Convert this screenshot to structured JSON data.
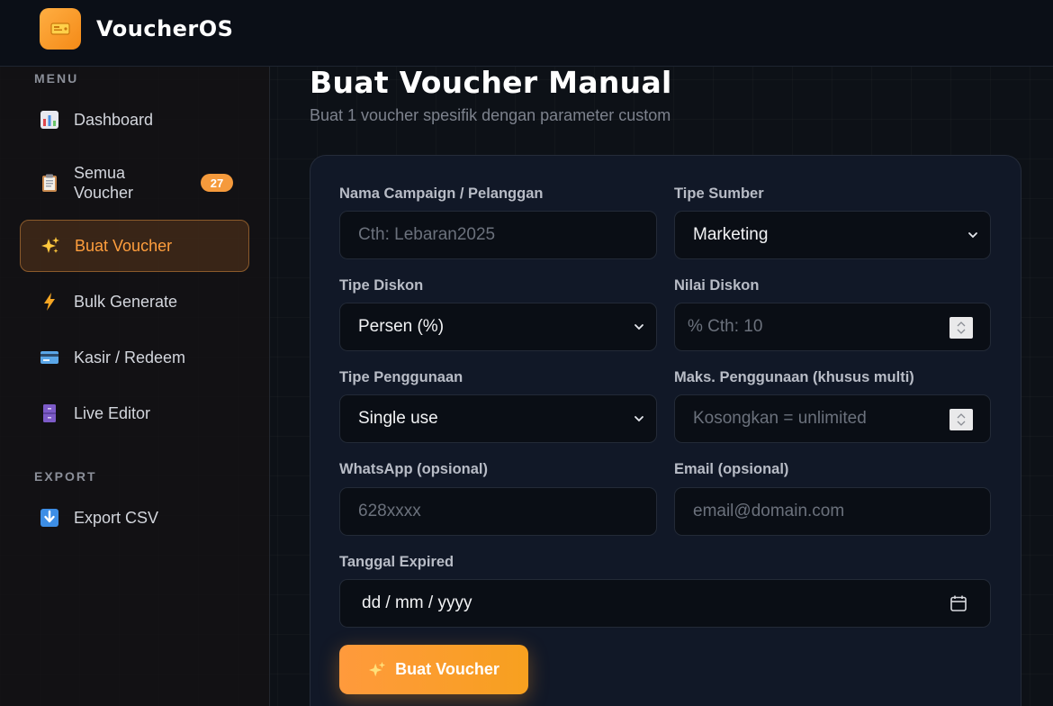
{
  "app": {
    "name": "VoucherOS",
    "accent": "#f59a3c"
  },
  "sidebar": {
    "menu_label": "MENU",
    "export_label": "EXPORT",
    "items": [
      {
        "label": "Dashboard",
        "icon": "bar-chart-icon"
      },
      {
        "label": "Semua Voucher",
        "icon": "clipboard-icon",
        "badge": "27"
      },
      {
        "label": "Buat Voucher",
        "icon": "sparkles-icon",
        "active": true
      },
      {
        "label": "Bulk Generate",
        "icon": "lightning-icon"
      },
      {
        "label": "Kasir / Redeem",
        "icon": "credit-card-icon"
      },
      {
        "label": "Live Editor",
        "icon": "file-cabinet-icon"
      }
    ],
    "export_items": [
      {
        "label": "Export CSV",
        "icon": "download-arrow-icon"
      }
    ]
  },
  "main": {
    "title": "Buat Voucher Manual",
    "subtitle": "Buat 1 voucher spesifik dengan parameter custom"
  },
  "form": {
    "campaign": {
      "label": "Nama Campaign / Pelanggan",
      "placeholder": "Cth: Lebaran2025",
      "value": ""
    },
    "source_type": {
      "label": "Tipe Sumber",
      "value": "Marketing"
    },
    "discount_type": {
      "label": "Tipe Diskon",
      "value": "Persen (%)"
    },
    "discount_value": {
      "label": "Nilai Diskon",
      "placeholder": "% Cth: 10",
      "value": ""
    },
    "usage_type": {
      "label": "Tipe Penggunaan",
      "value": "Single use"
    },
    "max_usage": {
      "label": "Maks. Penggunaan (khusus multi)",
      "placeholder": "Kosongkan = unlimited",
      "value": ""
    },
    "whatsapp": {
      "label": "WhatsApp (opsional)",
      "placeholder": "628xxxx",
      "value": ""
    },
    "email": {
      "label": "Email (opsional)",
      "placeholder": "email@domain.com",
      "value": ""
    },
    "expired": {
      "label": "Tanggal Expired",
      "value": "dd / mm / yyyy"
    },
    "submit_label": "Buat Voucher"
  }
}
